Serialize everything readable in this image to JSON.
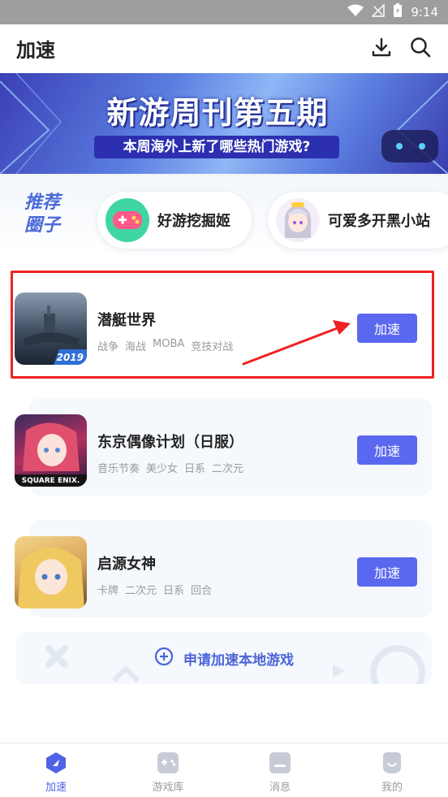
{
  "status_bar": {
    "time": "9:14"
  },
  "header": {
    "title": "加速"
  },
  "banner": {
    "title": "新游周刊第五期",
    "subtitle": "本周海外上新了哪些热门游戏?"
  },
  "recommend": {
    "label_line1": "推荐",
    "label_line2": "圈子",
    "items": [
      {
        "name": "好游挖掘姬"
      },
      {
        "name": "可爱多开黑小站"
      }
    ]
  },
  "games": [
    {
      "name": "潜艇世界",
      "tags": [
        "战争",
        "海战",
        "MOBA",
        "竞技对战"
      ],
      "badge": "2019",
      "button": "加速"
    },
    {
      "name": "东京偶像计划（日服）",
      "tags": [
        "音乐节奏",
        "美少女",
        "日系",
        "二次元"
      ],
      "badge": "SQUARE ENIX.",
      "button": "加速"
    },
    {
      "name": "启源女神",
      "tags": [
        "卡牌",
        "二次元",
        "日系",
        "回合"
      ],
      "button": "加速"
    }
  ],
  "request": {
    "label": "申请加速本地游戏"
  },
  "bottom_nav": [
    {
      "label": "加速",
      "active": true
    },
    {
      "label": "游戏库",
      "active": false
    },
    {
      "label": "消息",
      "active": false
    },
    {
      "label": "我的",
      "active": false
    }
  ],
  "colors": {
    "accent": "#5a68ef",
    "highlight": "#ee2222",
    "active_nav": "#4f63e6"
  }
}
